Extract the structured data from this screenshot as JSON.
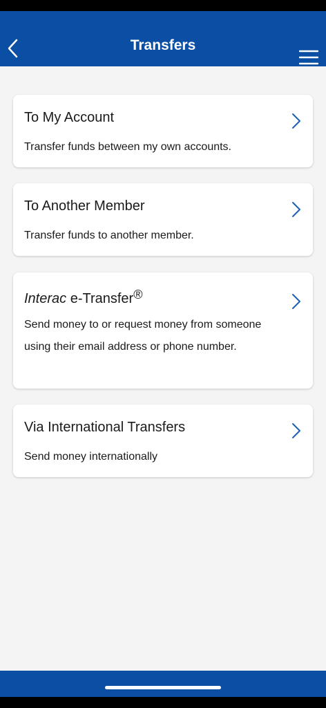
{
  "header": {
    "title": "Transfers",
    "back_icon": "chevron-left-icon",
    "menu_icon": "hamburger-menu-icon",
    "color": "#0a4fa3"
  },
  "cards": [
    {
      "title": "To My Account",
      "description": "Transfer funds between my own accounts."
    },
    {
      "title": "To Another Member",
      "description": "Transfer funds to another member."
    },
    {
      "title_italic": "Interac",
      "title_rest": " e-Transfer",
      "title_mark": "®",
      "description": "Send money to or request money from someone using their email address or phone number."
    },
    {
      "title": "Via International Transfers",
      "description": "Send money internationally"
    }
  ],
  "colors": {
    "accent": "#0a4fa3",
    "chevron": "#1a5fb4",
    "background": "#f4f4f4"
  }
}
